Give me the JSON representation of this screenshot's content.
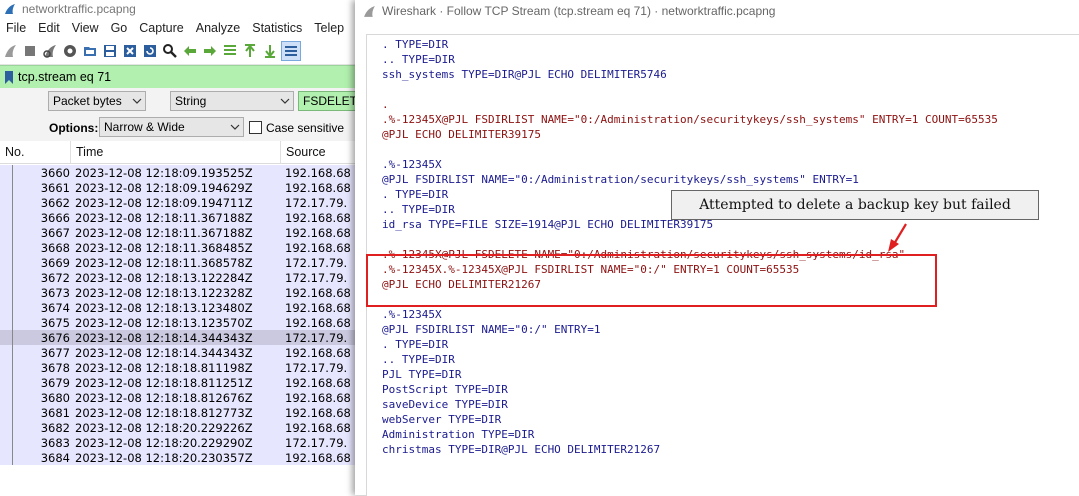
{
  "main": {
    "title": "networktraffic.pcapng",
    "menu": [
      "File",
      "Edit",
      "View",
      "Go",
      "Capture",
      "Analyze",
      "Statistics",
      "Telep"
    ],
    "filter": "tcp.stream eq 71",
    "find": {
      "display_type": "Packet bytes",
      "search_type": "String",
      "search_text": "FSDELETE",
      "options_label": "Options:",
      "char_width": "Narrow & Wide",
      "case_label": "Case sensitive"
    },
    "columns": [
      "No.",
      "Time",
      "Source"
    ],
    "rows": [
      {
        "no": "3660",
        "time": "2023-12-08 12:18:09.193525Z",
        "src": "192.168.68"
      },
      {
        "no": "3661",
        "time": "2023-12-08 12:18:09.194629Z",
        "src": "192.168.68"
      },
      {
        "no": "3662",
        "time": "2023-12-08 12:18:09.194711Z",
        "src": "172.17.79."
      },
      {
        "no": "3666",
        "time": "2023-12-08 12:18:11.367188Z",
        "src": "192.168.68"
      },
      {
        "no": "3667",
        "time": "2023-12-08 12:18:11.367188Z",
        "src": "192.168.68"
      },
      {
        "no": "3668",
        "time": "2023-12-08 12:18:11.368485Z",
        "src": "192.168.68"
      },
      {
        "no": "3669",
        "time": "2023-12-08 12:18:11.368578Z",
        "src": "172.17.79."
      },
      {
        "no": "3672",
        "time": "2023-12-08 12:18:13.122284Z",
        "src": "172.17.79."
      },
      {
        "no": "3673",
        "time": "2023-12-08 12:18:13.122328Z",
        "src": "192.168.68"
      },
      {
        "no": "3674",
        "time": "2023-12-08 12:18:13.123480Z",
        "src": "192.168.68"
      },
      {
        "no": "3675",
        "time": "2023-12-08 12:18:13.123570Z",
        "src": "192.168.68"
      },
      {
        "no": "3676",
        "time": "2023-12-08 12:18:14.344343Z",
        "src": "172.17.79."
      },
      {
        "no": "3677",
        "time": "2023-12-08 12:18:14.344343Z",
        "src": "192.168.68"
      },
      {
        "no": "3678",
        "time": "2023-12-08 12:18:18.811198Z",
        "src": "172.17.79."
      },
      {
        "no": "3679",
        "time": "2023-12-08 12:18:18.811251Z",
        "src": "192.168.68"
      },
      {
        "no": "3680",
        "time": "2023-12-08 12:18:18.812676Z",
        "src": "192.168.68"
      },
      {
        "no": "3681",
        "time": "2023-12-08 12:18:18.812773Z",
        "src": "192.168.68"
      },
      {
        "no": "3682",
        "time": "2023-12-08 12:18:20.229226Z",
        "src": "192.168.68"
      },
      {
        "no": "3683",
        "time": "2023-12-08 12:18:20.229290Z",
        "src": "172.17.79."
      },
      {
        "no": "3684",
        "time": "2023-12-08 12:18:20.230357Z",
        "src": "192.168.68"
      }
    ],
    "selected_row": "3676"
  },
  "follow": {
    "title": "Wireshark · Follow TCP Stream (tcp.stream eq 71) · networktraffic.pcapng",
    "lines": [
      {
        "t": ". TYPE=DIR",
        "c": "blue"
      },
      {
        "t": ".. TYPE=DIR",
        "c": "blue"
      },
      {
        "t": "ssh_systems TYPE=DIR@PJL ECHO DELIMITER5746",
        "c": "blue"
      },
      {
        "t": "",
        "c": "blue"
      },
      {
        "t": ".",
        "c": "red"
      },
      {
        "t": ".%-12345X@PJL FSDIRLIST NAME=\"0:/Administration/securitykeys/ssh_systems\" ENTRY=1 COUNT=65535",
        "c": "red"
      },
      {
        "t": "@PJL ECHO DELIMITER39175",
        "c": "red"
      },
      {
        "t": "",
        "c": "red"
      },
      {
        "t": ".%-12345X",
        "c": "blue"
      },
      {
        "t": "@PJL FSDIRLIST NAME=\"0:/Administration/securitykeys/ssh_systems\" ENTRY=1",
        "c": "blue"
      },
      {
        "t": ". TYPE=DIR",
        "c": "blue"
      },
      {
        "t": ".. TYPE=DIR",
        "c": "blue"
      },
      {
        "t": "id_rsa TYPE=FILE SIZE=1914@PJL ECHO DELIMITER39175",
        "c": "blue"
      },
      {
        "t": "",
        "c": "blue"
      },
      {
        "t": ".%-12345X@PJL FSDELETE NAME=\"0:/Administration/securitykeys/ssh_systems/id_rsa\"",
        "c": "red"
      },
      {
        "t": ".%-12345X.%-12345X@PJL FSDIRLIST NAME=\"0:/\" ENTRY=1 COUNT=65535",
        "c": "red"
      },
      {
        "t": "@PJL ECHO DELIMITER21267",
        "c": "red"
      },
      {
        "t": "",
        "c": "red"
      },
      {
        "t": ".%-12345X",
        "c": "blue"
      },
      {
        "t": "@PJL FSDIRLIST NAME=\"0:/\" ENTRY=1",
        "c": "blue"
      },
      {
        "t": ". TYPE=DIR",
        "c": "blue"
      },
      {
        "t": ".. TYPE=DIR",
        "c": "blue"
      },
      {
        "t": "PJL TYPE=DIR",
        "c": "blue"
      },
      {
        "t": "PostScript TYPE=DIR",
        "c": "blue"
      },
      {
        "t": "saveDevice TYPE=DIR",
        "c": "blue"
      },
      {
        "t": "webServer TYPE=DIR",
        "c": "blue"
      },
      {
        "t": "Administration TYPE=DIR",
        "c": "blue"
      },
      {
        "t": "christmas TYPE=DIR@PJL ECHO DELIMITER21267",
        "c": "blue"
      }
    ]
  },
  "annotation": {
    "text": "Attempted to delete a backup key but failed",
    "highlight_color": "#e02020"
  }
}
